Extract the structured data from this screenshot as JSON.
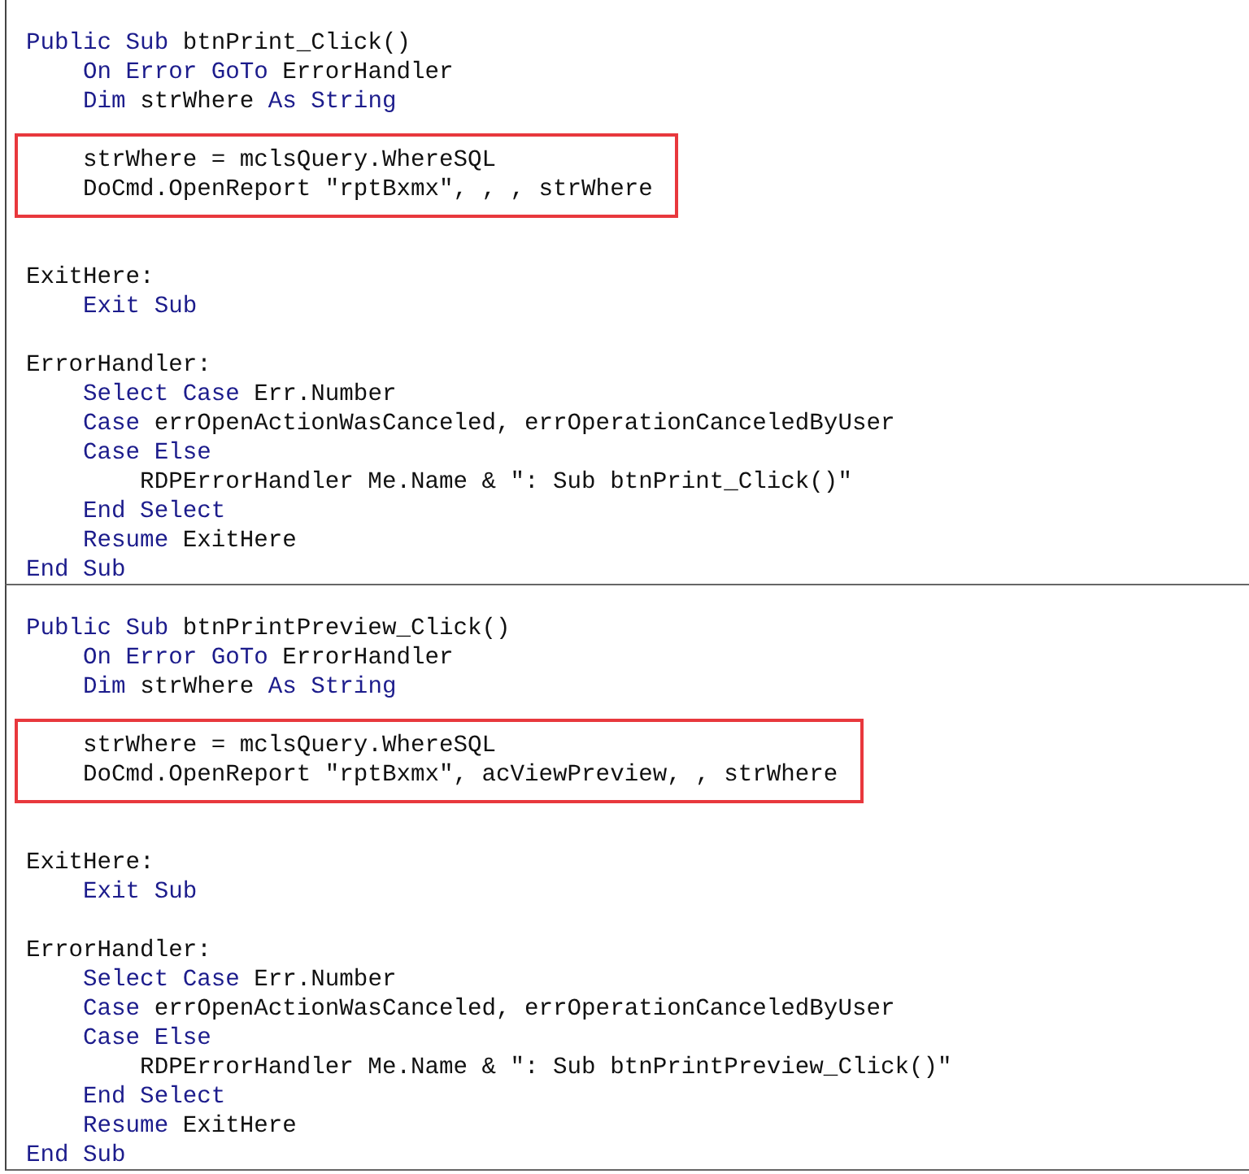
{
  "procedures": [
    {
      "blocks": [
        {
          "boxed": false,
          "lines": [
            {
              "kind": "code",
              "segments": [
                {
                  "kind": "keyword",
                  "text": "Public Sub"
                },
                {
                  "kind": "plain",
                  "text": " btnPrint_Click()"
                }
              ]
            },
            {
              "kind": "code",
              "segments": [
                {
                  "kind": "keyword",
                  "text": "    On Error GoTo"
                },
                {
                  "kind": "plain",
                  "text": " ErrorHandler"
                }
              ]
            },
            {
              "kind": "code",
              "segments": [
                {
                  "kind": "keyword",
                  "text": "    Dim"
                },
                {
                  "kind": "plain",
                  "text": " strWhere "
                },
                {
                  "kind": "keyword",
                  "text": "As String"
                }
              ]
            },
            {
              "kind": "blank"
            }
          ]
        },
        {
          "boxed": true,
          "lines": [
            {
              "kind": "code",
              "segments": [
                {
                  "kind": "plain",
                  "text": "    strWhere = mclsQuery.WhereSQL"
                }
              ]
            },
            {
              "kind": "code",
              "segments": [
                {
                  "kind": "plain",
                  "text": "    DoCmd.OpenReport \"rptBxmx\", , , strWhere"
                }
              ]
            }
          ]
        },
        {
          "boxed": false,
          "lines": [
            {
              "kind": "blank"
            },
            {
              "kind": "blank"
            },
            {
              "kind": "code",
              "segments": [
                {
                  "kind": "plain",
                  "text": "ExitHere:"
                }
              ]
            },
            {
              "kind": "code",
              "segments": [
                {
                  "kind": "keyword",
                  "text": "    Exit Sub"
                }
              ]
            },
            {
              "kind": "blank"
            },
            {
              "kind": "code",
              "segments": [
                {
                  "kind": "plain",
                  "text": "ErrorHandler:"
                }
              ]
            },
            {
              "kind": "code",
              "segments": [
                {
                  "kind": "keyword",
                  "text": "    Select Case"
                },
                {
                  "kind": "plain",
                  "text": " Err.Number"
                }
              ]
            },
            {
              "kind": "code",
              "segments": [
                {
                  "kind": "keyword",
                  "text": "    Case"
                },
                {
                  "kind": "plain",
                  "text": " errOpenActionWasCanceled, errOperationCanceledByUser"
                }
              ]
            },
            {
              "kind": "code",
              "segments": [
                {
                  "kind": "keyword",
                  "text": "    Case Else"
                }
              ]
            },
            {
              "kind": "code",
              "segments": [
                {
                  "kind": "plain",
                  "text": "        RDPErrorHandler Me.Name & \": Sub btnPrint_Click()\""
                }
              ]
            },
            {
              "kind": "code",
              "segments": [
                {
                  "kind": "keyword",
                  "text": "    End Select"
                }
              ]
            },
            {
              "kind": "code",
              "segments": [
                {
                  "kind": "keyword",
                  "text": "    Resume"
                },
                {
                  "kind": "plain",
                  "text": " ExitHere"
                }
              ]
            },
            {
              "kind": "code",
              "segments": [
                {
                  "kind": "keyword",
                  "text": "End Sub"
                }
              ]
            }
          ]
        }
      ]
    },
    {
      "blocks": [
        {
          "boxed": false,
          "lines": [
            {
              "kind": "code",
              "segments": [
                {
                  "kind": "keyword",
                  "text": "Public Sub"
                },
                {
                  "kind": "plain",
                  "text": " btnPrintPreview_Click()"
                }
              ]
            },
            {
              "kind": "code",
              "segments": [
                {
                  "kind": "keyword",
                  "text": "    On Error GoTo"
                },
                {
                  "kind": "plain",
                  "text": " ErrorHandler"
                }
              ]
            },
            {
              "kind": "code",
              "segments": [
                {
                  "kind": "keyword",
                  "text": "    Dim"
                },
                {
                  "kind": "plain",
                  "text": " strWhere "
                },
                {
                  "kind": "keyword",
                  "text": "As String"
                }
              ]
            },
            {
              "kind": "blank"
            }
          ]
        },
        {
          "boxed": true,
          "lines": [
            {
              "kind": "code",
              "segments": [
                {
                  "kind": "plain",
                  "text": "    strWhere = mclsQuery.WhereSQL"
                }
              ]
            },
            {
              "kind": "code",
              "segments": [
                {
                  "kind": "plain",
                  "text": "    DoCmd.OpenReport \"rptBxmx\", acViewPreview, , strWhere"
                }
              ]
            }
          ]
        },
        {
          "boxed": false,
          "lines": [
            {
              "kind": "blank"
            },
            {
              "kind": "blank"
            },
            {
              "kind": "code",
              "segments": [
                {
                  "kind": "plain",
                  "text": "ExitHere:"
                }
              ]
            },
            {
              "kind": "code",
              "segments": [
                {
                  "kind": "keyword",
                  "text": "    Exit Sub"
                }
              ]
            },
            {
              "kind": "blank"
            },
            {
              "kind": "code",
              "segments": [
                {
                  "kind": "plain",
                  "text": "ErrorHandler:"
                }
              ]
            },
            {
              "kind": "code",
              "segments": [
                {
                  "kind": "keyword",
                  "text": "    Select Case"
                },
                {
                  "kind": "plain",
                  "text": " Err.Number"
                }
              ]
            },
            {
              "kind": "code",
              "segments": [
                {
                  "kind": "keyword",
                  "text": "    Case"
                },
                {
                  "kind": "plain",
                  "text": " errOpenActionWasCanceled, errOperationCanceledByUser"
                }
              ]
            },
            {
              "kind": "code",
              "segments": [
                {
                  "kind": "keyword",
                  "text": "    Case Else"
                }
              ]
            },
            {
              "kind": "code",
              "segments": [
                {
                  "kind": "plain",
                  "text": "        RDPErrorHandler Me.Name & \": Sub btnPrintPreview_Click()\""
                }
              ]
            },
            {
              "kind": "code",
              "segments": [
                {
                  "kind": "keyword",
                  "text": "    End Select"
                }
              ]
            },
            {
              "kind": "code",
              "segments": [
                {
                  "kind": "keyword",
                  "text": "    Resume"
                },
                {
                  "kind": "plain",
                  "text": " ExitHere"
                }
              ]
            },
            {
              "kind": "code",
              "segments": [
                {
                  "kind": "keyword",
                  "text": "End Sub"
                }
              ]
            }
          ]
        }
      ]
    }
  ]
}
